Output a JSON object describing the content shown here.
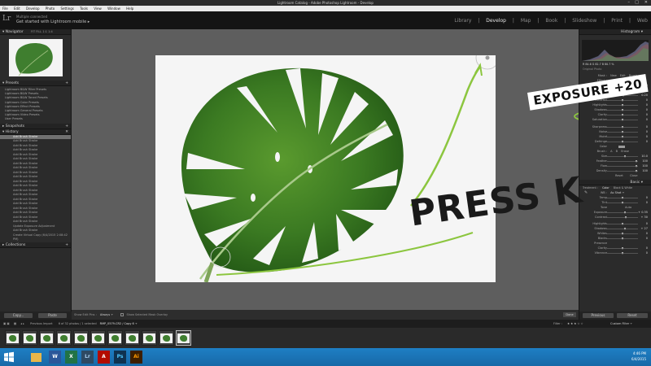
{
  "window": {
    "title": "Lightroom Catalog - Adobe Photoshop Lightroom - Develop"
  },
  "menu": [
    "File",
    "Edit",
    "Develop",
    "Photo",
    "Settings",
    "Tools",
    "View",
    "Window",
    "Help"
  ],
  "identity": {
    "logo": "Lr",
    "line1": "Multiple connected",
    "line2": "Get started with Lightroom mobile ▸"
  },
  "modules": {
    "library": "Library",
    "develop": "Develop",
    "map": "Map",
    "book": "Book",
    "slideshow": "Slideshow",
    "print": "Print",
    "web": "Web",
    "active": "Develop"
  },
  "left_panel": {
    "navigator_label": "Navigator",
    "navigator_zoom": "FIT  FILL  1:1  1:4",
    "presets_label": "Presets",
    "presets": [
      "Lightroom B&W Filter Presets",
      "Lightroom B&W Presets",
      "Lightroom B&W Toned Presets",
      "Lightroom Color Presets",
      "Lightroom Effect Presets",
      "Lightroom General Presets",
      "Lightroom Video Presets",
      "User Presets"
    ],
    "snapshots_label": "Snapshots",
    "history_label": "History",
    "history": [
      "Add Brush Stroke",
      "Add Brush Stroke",
      "Add Brush Stroke",
      "Add Brush Stroke",
      "Add Brush Stroke",
      "Add Brush Stroke",
      "Add Brush Stroke",
      "Add Brush Stroke",
      "Add Brush Stroke",
      "Add Brush Stroke",
      "Add Brush Stroke",
      "Add Brush Stroke",
      "Add Brush Stroke",
      "Add Brush Stroke",
      "Add Brush Stroke",
      "Add Brush Stroke",
      "Add Brush Stroke",
      "Add Brush Stroke",
      "Add Brush Stroke",
      "Add Brush Stroke",
      "Update Exposure Adjustment",
      "Add Brush Stroke",
      "Create Virtual Copy (6/4/2015 2:08:42 PM)"
    ],
    "collections_label": "Collections",
    "copy_button": "Copy...",
    "paste_button": "Paste"
  },
  "toolbar": {
    "mask_label": "Show Edit Pins :",
    "mask_value": "Always ÷",
    "overlay_label": "Show Selected Mask Overlay",
    "done_button": "Done"
  },
  "right_panel": {
    "histogram_label": "Histogram",
    "stats": "R  84.6   G  82.7   B  80.7 %",
    "original_photo": "Original Photo",
    "mask_label": "Mask :",
    "mask_new": "New",
    "mask_edit": "Edit",
    "mask_brush": "Brush",
    "effect_label": "Effect :",
    "sliders_top": [
      {
        "label": "Temp",
        "value": "0",
        "pos": 0.5
      },
      {
        "label": "Tint",
        "value": "0",
        "pos": 0.5
      },
      {
        "label": "Exposure",
        "value": "0.20",
        "pos": 0.54
      },
      {
        "label": "Contrast",
        "value": "0",
        "pos": 0.5
      },
      {
        "label": "Highlights",
        "value": "0",
        "pos": 0.5
      },
      {
        "label": "Shadows",
        "value": "0",
        "pos": 0.5
      },
      {
        "label": "Clarity",
        "value": "0",
        "pos": 0.5
      },
      {
        "label": "Saturation",
        "value": "0",
        "pos": 0.5
      }
    ],
    "sliders_mid": [
      {
        "label": "Sharpness",
        "value": "0",
        "pos": 0.5
      },
      {
        "label": "Noise",
        "value": "0",
        "pos": 0.5
      },
      {
        "label": "Moiré",
        "value": "0",
        "pos": 0.5
      },
      {
        "label": "Defringe",
        "value": "0",
        "pos": 0.5
      }
    ],
    "color_label": "Color",
    "brush_label": "Brush :",
    "brush_a": "A",
    "brush_b": "B",
    "brush_erase": "Erase",
    "brush_sliders": [
      {
        "label": "Size",
        "value": "10.0",
        "pos": 0.6
      },
      {
        "label": "Feather",
        "value": "100",
        "pos": 0.95
      },
      {
        "label": "Flow",
        "value": "100",
        "pos": 0.95
      },
      {
        "label": "Density",
        "value": "100",
        "pos": 0.95
      }
    ],
    "automask": "Auto Mask",
    "reset": "Reset",
    "close": "Close",
    "basic_label": "Basic",
    "treatment_label": "Treatment :",
    "treatment_color": "Color",
    "treatment_bw": "Black & White",
    "wb_label": "WB :",
    "wb_value": "As Shot ÷",
    "basic_sliders_a": [
      {
        "label": "Temp",
        "value": "0",
        "pos": 0.5
      },
      {
        "label": "Tint",
        "value": "0",
        "pos": 0.5
      }
    ],
    "tone_label": "Tone",
    "tone_auto": "Auto",
    "basic_sliders_b": [
      {
        "label": "Exposure",
        "value": "+ 0.35",
        "pos": 0.6
      },
      {
        "label": "Contrast",
        "value": "+ 30",
        "pos": 0.62
      }
    ],
    "basic_sliders_c": [
      {
        "label": "Highlights",
        "value": "0",
        "pos": 0.5
      },
      {
        "label": "Shadows",
        "value": "+ 27",
        "pos": 0.6
      },
      {
        "label": "Whites",
        "value": "0",
        "pos": 0.5
      },
      {
        "label": "Blacks",
        "value": "0",
        "pos": 0.5
      }
    ],
    "presence_label": "Presence",
    "basic_sliders_d": [
      {
        "label": "Clarity",
        "value": "0",
        "pos": 0.5
      },
      {
        "label": "Vibrance",
        "value": "0",
        "pos": 0.5
      }
    ],
    "previous_button": "Previous",
    "reset_button": "Reset"
  },
  "filmstrip": {
    "source": "Previous Import",
    "count": "6 of 32 photos / 1 selected",
    "filename": "RMP_0579.CR2 / Copy 6 ÷",
    "filter_label": "Filter :",
    "filter_value": "Custom Filter ÷",
    "thumbnail_count": 11
  },
  "overlays": {
    "exposure_text": "EXPOSURE +20",
    "press_k_text": "PRESS K",
    "accent_color": "#8cc63f"
  },
  "taskbar": {
    "time": "4:46 PM",
    "date": "6/4/2015",
    "apps": [
      "explorer-icon",
      "word-icon",
      "excel-icon",
      "lightroom-icon",
      "acrobat-icon",
      "photoshop-icon",
      "illustrator-icon"
    ]
  }
}
